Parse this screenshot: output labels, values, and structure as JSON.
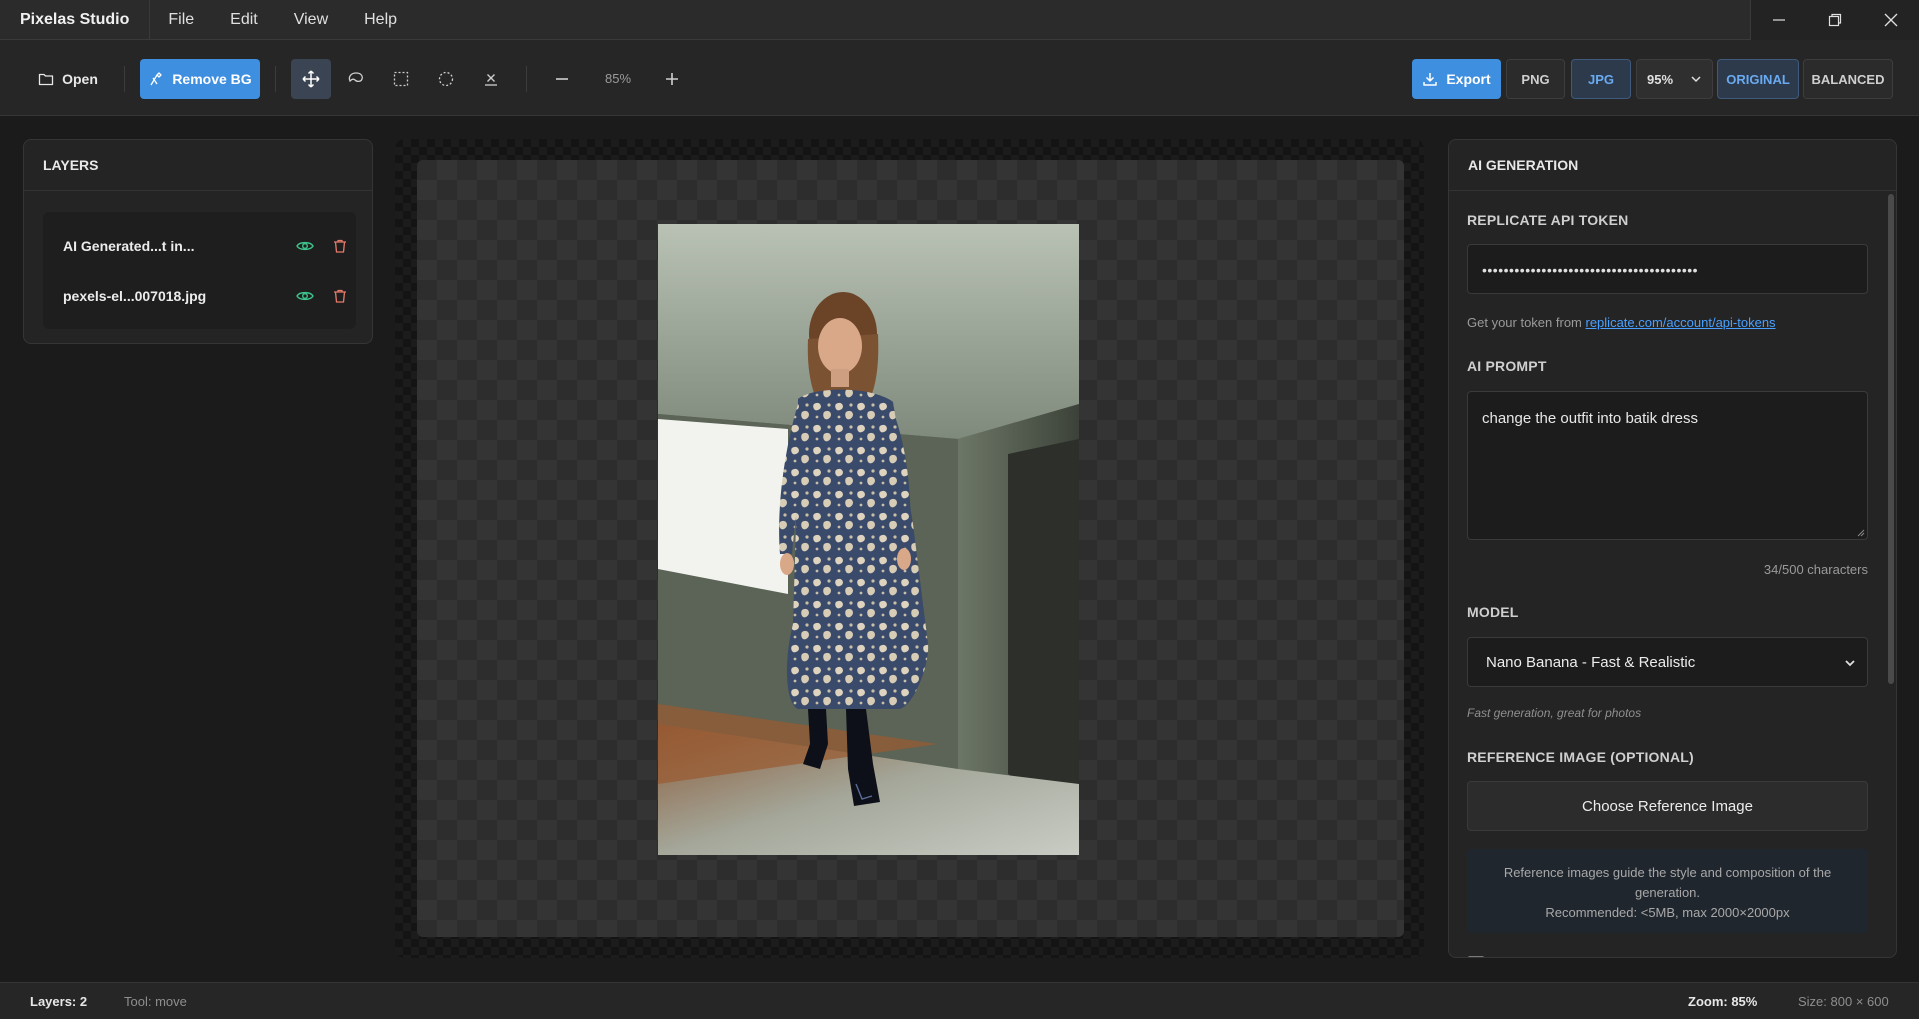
{
  "app": {
    "title": "Pixelas Studio"
  },
  "menu": [
    "File",
    "Edit",
    "View",
    "Help"
  ],
  "toolbar": {
    "open_label": "Open",
    "remove_bg_label": "Remove BG",
    "zoom": "85%",
    "export_label": "Export",
    "formats": [
      "PNG",
      "JPG"
    ],
    "selected_format": "JPG",
    "quality": "95%",
    "modes": [
      "ORIGINAL",
      "BALANCED"
    ],
    "selected_mode": "ORIGINAL",
    "accent_color": "#3f8fe0"
  },
  "layers": {
    "title": "LAYERS",
    "items": [
      {
        "name": "AI Generated...t in...",
        "visible": true
      },
      {
        "name": "pexels-el...007018.jpg",
        "visible": true
      }
    ]
  },
  "ai": {
    "title": "AI GENERATION",
    "token_label": "REPLICATE API TOKEN",
    "token_value": "••••••••••••••••••••••••••••••••••••••••",
    "token_hint": "Get your token from ",
    "token_link": "replicate.com/account/api-tokens",
    "prompt_label": "AI PROMPT",
    "prompt_value": "change the outfit into batik dress",
    "char_count": "34/500 characters",
    "model_label": "MODEL",
    "model_value": "Nano Banana - Fast & Realistic",
    "model_desc": "Fast generation, great for photos",
    "reference_label": "REFERENCE IMAGE (OPTIONAL)",
    "reference_button": "Choose Reference Image",
    "reference_note_1": "Reference images guide the style and composition of the generation.",
    "reference_note_2": "Recommended: <5MB, max 2000×2000px"
  },
  "status": {
    "layers": "Layers: 2",
    "tool": "Tool: move",
    "zoom": "Zoom: 85%",
    "size": "Size: 800 × 600"
  }
}
